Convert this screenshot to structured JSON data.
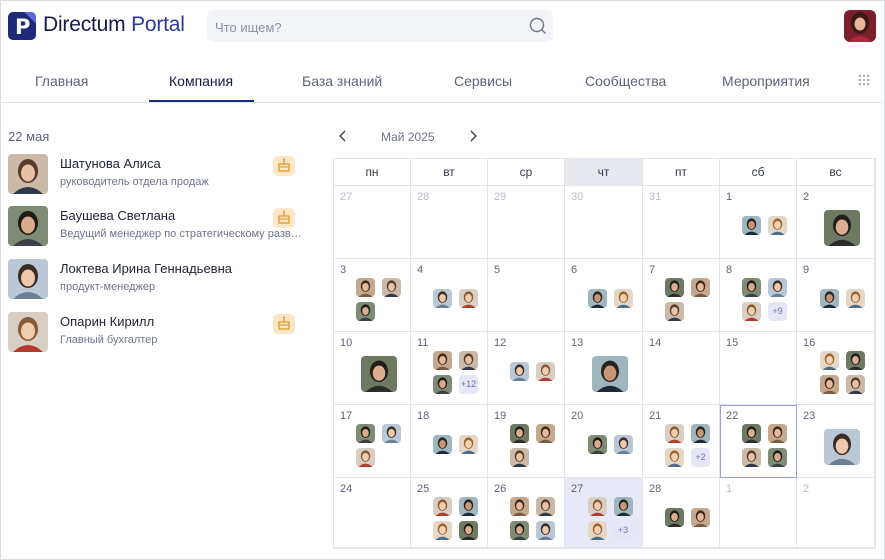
{
  "header": {
    "brand_name": "Directum",
    "brand_product": "Portal",
    "search_placeholder": "Что ищем?"
  },
  "nav": {
    "tabs": [
      "Главная",
      "Компания",
      "База знаний",
      "Сервисы",
      "Сообщества",
      "Мероприятия"
    ],
    "active_tab": "Компания"
  },
  "birthdays": {
    "date": "22 мая",
    "people": [
      {
        "name": "Шатунова Алиса",
        "role": "руководитель отдела продаж",
        "cake": true
      },
      {
        "name": "Баушева Светлана",
        "role": "Ведущий менеджер по стратегическому развитию",
        "cake": true
      },
      {
        "name": "Локтева Ирина Геннадьевна",
        "role": "продукт-менеджер",
        "cake": false
      },
      {
        "name": "Опарин Кирилл",
        "role": "Главный бухгалтер",
        "cake": true
      }
    ]
  },
  "calendar": {
    "month_label": "Май 2025",
    "weekdays": [
      "пн",
      "вт",
      "ср",
      "чт",
      "пт",
      "сб",
      "вс"
    ],
    "today_weekday": "чт",
    "weeks": [
      [
        {
          "day": "27",
          "muted": true,
          "avatars": 0
        },
        {
          "day": "28",
          "muted": true,
          "avatars": 0
        },
        {
          "day": "29",
          "muted": true,
          "avatars": 0
        },
        {
          "day": "30",
          "muted": true,
          "avatars": 0
        },
        {
          "day": "31",
          "muted": true,
          "avatars": 0
        },
        {
          "day": "1",
          "avatars": 2
        },
        {
          "day": "2",
          "avatars": 1
        }
      ],
      [
        {
          "day": "3",
          "avatars": 3
        },
        {
          "day": "4",
          "avatars": 2
        },
        {
          "day": "5",
          "avatars": 0
        },
        {
          "day": "6",
          "avatars": 2
        },
        {
          "day": "7",
          "avatars": 3
        },
        {
          "day": "8",
          "avatars": 3,
          "more": "+9"
        },
        {
          "day": "9",
          "avatars": 2
        }
      ],
      [
        {
          "day": "10",
          "avatars": 1
        },
        {
          "day": "11",
          "avatars": 3,
          "more": "+12"
        },
        {
          "day": "12",
          "avatars": 2
        },
        {
          "day": "13",
          "avatars": 1
        },
        {
          "day": "14",
          "avatars": 0
        },
        {
          "day": "15",
          "avatars": 0
        },
        {
          "day": "16",
          "avatars": 4
        }
      ],
      [
        {
          "day": "17",
          "avatars": 3
        },
        {
          "day": "18",
          "avatars": 2
        },
        {
          "day": "19",
          "avatars": 3
        },
        {
          "day": "20",
          "avatars": 2
        },
        {
          "day": "21",
          "avatars": 3,
          "more": "+2"
        },
        {
          "day": "22",
          "avatars": 4,
          "selected": true
        },
        {
          "day": "23",
          "avatars": 1
        }
      ],
      [
        {
          "day": "24",
          "avatars": 0
        },
        {
          "day": "25",
          "avatars": 4
        },
        {
          "day": "26",
          "avatars": 4
        },
        {
          "day": "27",
          "avatars": 3,
          "more": "+3",
          "today": true
        },
        {
          "day": "28",
          "avatars": 2
        },
        {
          "day": "1",
          "muted": true,
          "avatars": 0
        },
        {
          "day": "2",
          "muted": true,
          "avatars": 0
        }
      ]
    ]
  },
  "colors": {
    "brand": "#1c2a78",
    "accent_underline": "#1c2a78",
    "today_bg": "#e8e9f7",
    "more_badge": "#e5e7f6",
    "cake_badge": "#fde7c7"
  },
  "icons": [
    "search-icon",
    "apps-grid-icon",
    "chevron-left-icon",
    "chevron-right-icon",
    "cake-icon"
  ]
}
